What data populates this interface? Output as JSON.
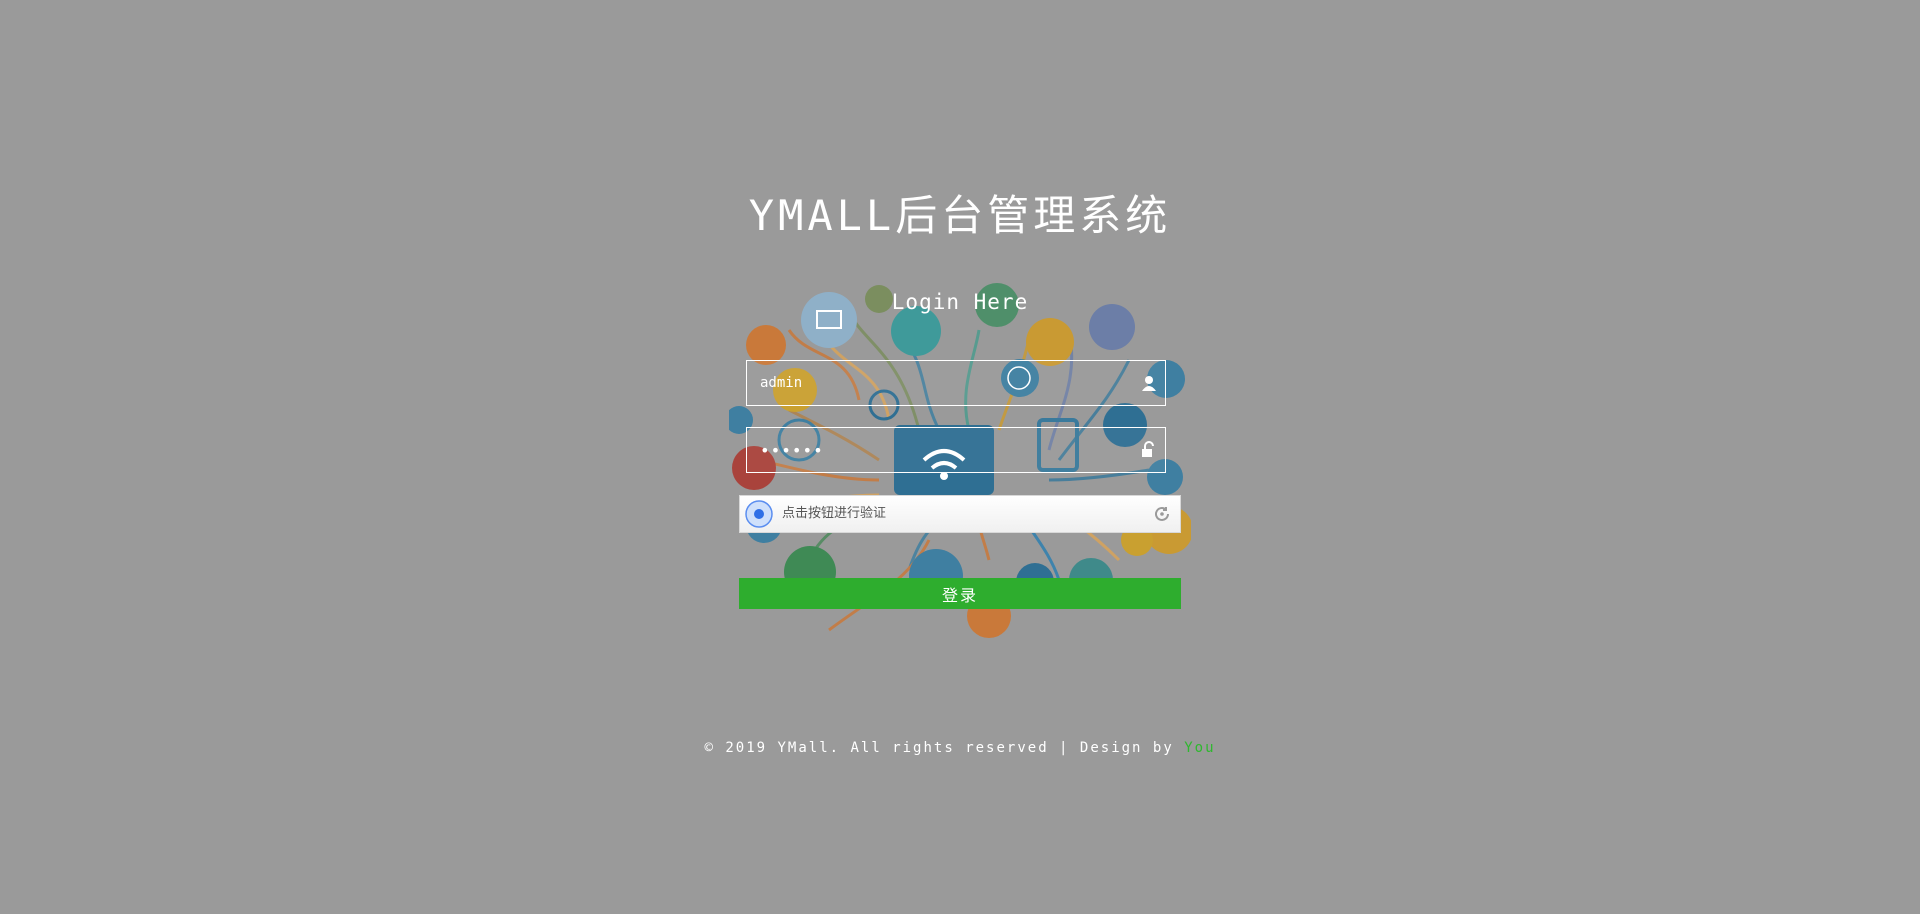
{
  "page_title": "YMALL后台管理系统",
  "login": {
    "heading": "Login Here",
    "username_value": "admin",
    "password_value": "••••••",
    "captcha_text": "点击按钮进行验证",
    "submit_label": "登录"
  },
  "footer": {
    "copyright": "© 2019 YMall. All rights reserved | Design by ",
    "designer": "You"
  },
  "colors": {
    "background": "#9a9a9a",
    "button": "#2ead2e",
    "designer_link": "#2eb82e"
  },
  "icons": {
    "username_field": "user-icon",
    "password_field": "lock-icon",
    "captcha": "captcha-target-icon",
    "captcha_refresh": "refresh-icon"
  }
}
